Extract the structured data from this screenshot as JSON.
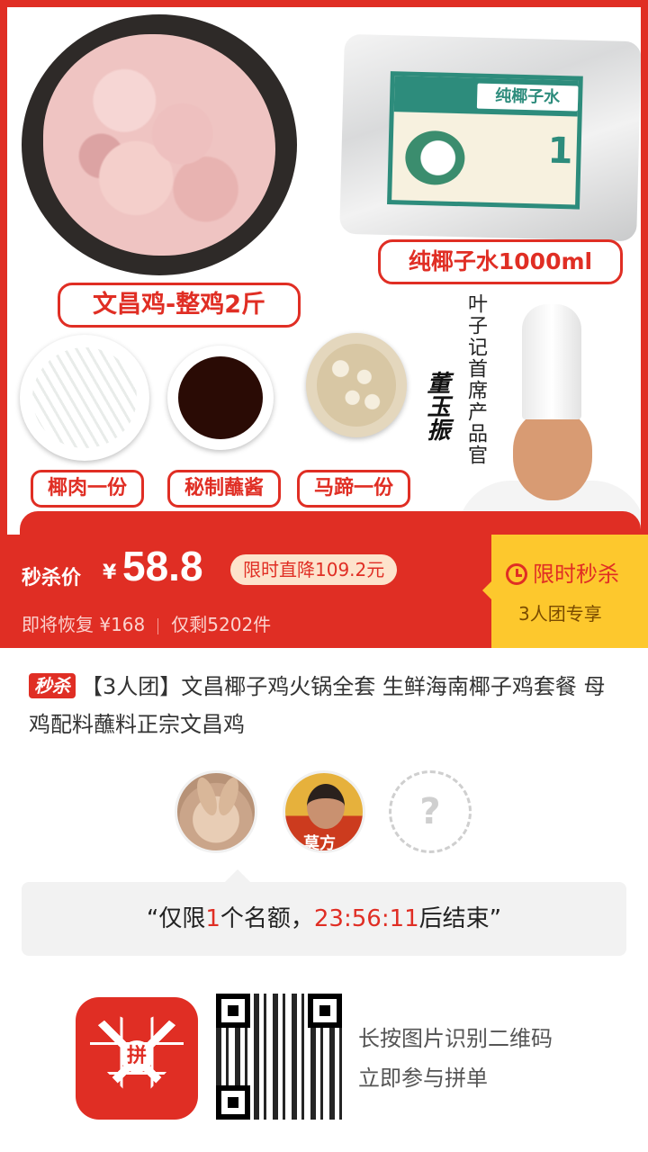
{
  "product_image": {
    "labels": {
      "chicken": "文昌鸡-整鸡2斤",
      "coconut_water": "纯椰子水1000ml",
      "coconut_meat": "椰肉一份",
      "sauce": "秘制蘸酱",
      "water_chestnut": "马蹄一份"
    },
    "pack_label": {
      "title": "纯椰子水",
      "number": "1"
    },
    "chef_title": "叶子记首席产品官",
    "chef_signature": "董玉振"
  },
  "price_bar": {
    "label": "秒杀价",
    "currency": "¥",
    "price": "58.8",
    "discount_tag": "限时直降109.2元",
    "original_price": "即将恢复 ¥168",
    "stock": "仅剩5202件",
    "flash_title": "限时秒杀",
    "flash_subtitle": "3人团专享"
  },
  "product": {
    "badge": "秒杀",
    "title": "【3人团】文昌椰子鸡火锅全套 生鲜海南椰子鸡套餐 母鸡配料蘸料正宗文昌鸡"
  },
  "group": {
    "member2_caption": "莫方",
    "empty_slot": "?"
  },
  "quota": {
    "prefix": "“仅限",
    "count": "1",
    "middle": "个名额，",
    "countdown": "23:56:11",
    "suffix": "后结束”"
  },
  "footer": {
    "logo_char": "拼",
    "scan_line1": "长按图片识别二维码",
    "scan_line2": "立即参与拼单"
  },
  "colors": {
    "accent": "#e02e24",
    "flash": "#fdc82d"
  }
}
